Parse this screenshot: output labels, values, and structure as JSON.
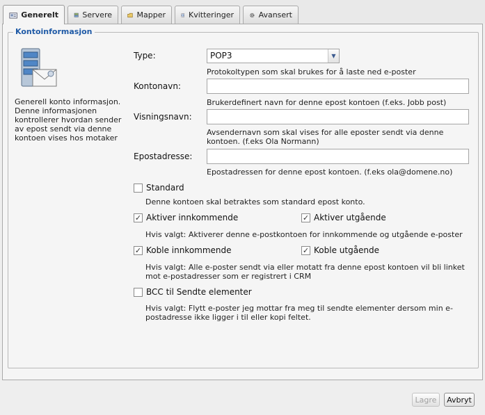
{
  "tabs": [
    {
      "label": "Generelt",
      "icon": "card-icon",
      "active": true
    },
    {
      "label": "Servere",
      "icon": "server-icon"
    },
    {
      "label": "Mapper",
      "icon": "folder-icon"
    },
    {
      "label": "Kvitteringer",
      "icon": "receipt-icon"
    },
    {
      "label": "Avansert",
      "icon": "gear-icon"
    }
  ],
  "section": {
    "legend": "Kontoinformasjon",
    "description": "Generell konto informasjon. Denne informasjonen kontrollerer hvordan sender av epost sendt via denne kontoen vises hos motaker"
  },
  "fields": {
    "type": {
      "label": "Type:",
      "value": "POP3",
      "help": "Protokoltypen som skal brukes for å laste ned e-poster"
    },
    "account_name": {
      "label": "Kontonavn:",
      "value": "",
      "help": "Brukerdefinert navn for denne epost kontoen (f.eks. Jobb post)"
    },
    "display_name": {
      "label": "Visningsnavn:",
      "value": "",
      "help": "Avsendernavn som skal vises for alle eposter sendt via denne kontoen. (f.eks Ola Normann)"
    },
    "email": {
      "label": "Epostadresse:",
      "value": "",
      "help": "Epostadressen for denne epost kontoen. (f.eks ola@domene.no)"
    }
  },
  "options": {
    "standard": {
      "label": "Standard",
      "checked": false,
      "help": "Denne kontoen skal betraktes som standard epost konto."
    },
    "incoming": {
      "label": "Aktiver innkommende",
      "checked": true
    },
    "outgoing": {
      "label": "Aktiver utgående",
      "checked": true
    },
    "activate_help": "Hvis valgt: Aktiverer denne e-postkontoen for innkommende og utgående e-poster",
    "link_incoming": {
      "label": "Koble innkommende",
      "checked": true
    },
    "link_outgoing": {
      "label": "Koble utgående",
      "checked": true
    },
    "link_help": "Hvis valgt: Alle e-poster sendt via eller motatt fra denne epost kontoen vil bli linket mot e-postadresser som er registrert i CRM",
    "bcc": {
      "label": "BCC til Sendte elementer",
      "checked": false,
      "help": "Hvis valgt: Flytt e-poster jeg mottar fra meg til sendte elementer dersom min e-postadresse ikke ligger i til eller kopi feltet."
    }
  },
  "buttons": {
    "save": "Lagre",
    "cancel": "Avbryt"
  },
  "check_glyph": "✓"
}
